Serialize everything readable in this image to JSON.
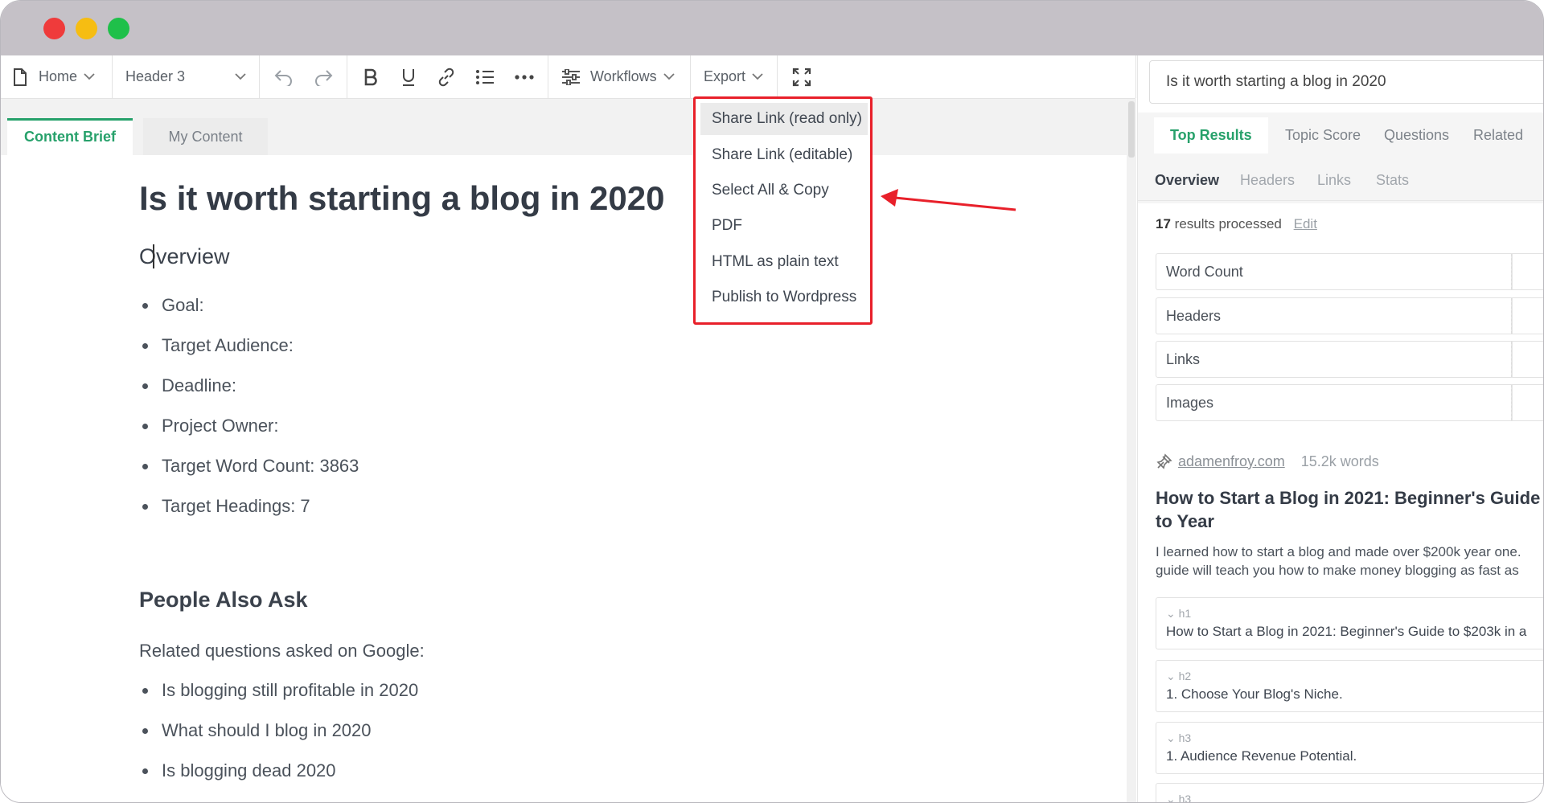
{
  "toolbar": {
    "home_label": "Home",
    "style_label": "Header 3",
    "workflows_label": "Workflows",
    "export_label": "Export"
  },
  "tabs": [
    {
      "label": "Content Brief",
      "active": true
    },
    {
      "label": "My Content",
      "active": false
    }
  ],
  "document": {
    "title": "Is it worth starting a blog in 2020",
    "overview_heading": "Overview",
    "overview_items": [
      "Goal:",
      "Target Audience:",
      "Deadline:",
      "Project Owner:",
      "Target Word Count: 3863",
      "Target Headings: 7"
    ],
    "paa_heading": "People Also Ask",
    "paa_intro": "Related questions asked on Google:",
    "paa_items": [
      "Is blogging still profitable in 2020",
      "What should I blog in 2020",
      "Is blogging dead 2020"
    ]
  },
  "export_menu": {
    "items": [
      "Share Link (read only)",
      "Share Link (editable)",
      "Select All & Copy",
      "PDF",
      "HTML as plain text",
      "Publish to Wordpress"
    ],
    "highlight_color": "#e8202a"
  },
  "right_panel": {
    "search_value": "Is it worth starting a blog in 2020",
    "tabs": [
      "Top Results",
      "Topic Score",
      "Questions",
      "Related"
    ],
    "subtabs": [
      "Overview",
      "Headers",
      "Links",
      "Stats"
    ],
    "processed_count": "17",
    "processed_text": "results processed",
    "edit_label": "Edit",
    "metrics": [
      "Word Count",
      "Headers",
      "Links",
      "Images"
    ],
    "result": {
      "domain": "adamenfroy.com",
      "words": "15.2k words",
      "title": "How to Start a Blog in 2021: Beginner's Guide to Year",
      "snippet_line1": "I learned how to start a blog and made over $200k year one.",
      "snippet_line2": "guide will teach you how to make money blogging as fast as",
      "headings": [
        {
          "tag": "h1",
          "text": "How to Start a Blog in 2021: Beginner's Guide to $203k in a"
        },
        {
          "tag": "h2",
          "text": "1. Choose Your Blog's Niche."
        },
        {
          "tag": "h3",
          "text": "1. Audience Revenue Potential."
        },
        {
          "tag": "h3",
          "text": ""
        }
      ]
    }
  },
  "colors": {
    "accent_green": "#27a16b",
    "titlebar": "#c5c1c7"
  }
}
